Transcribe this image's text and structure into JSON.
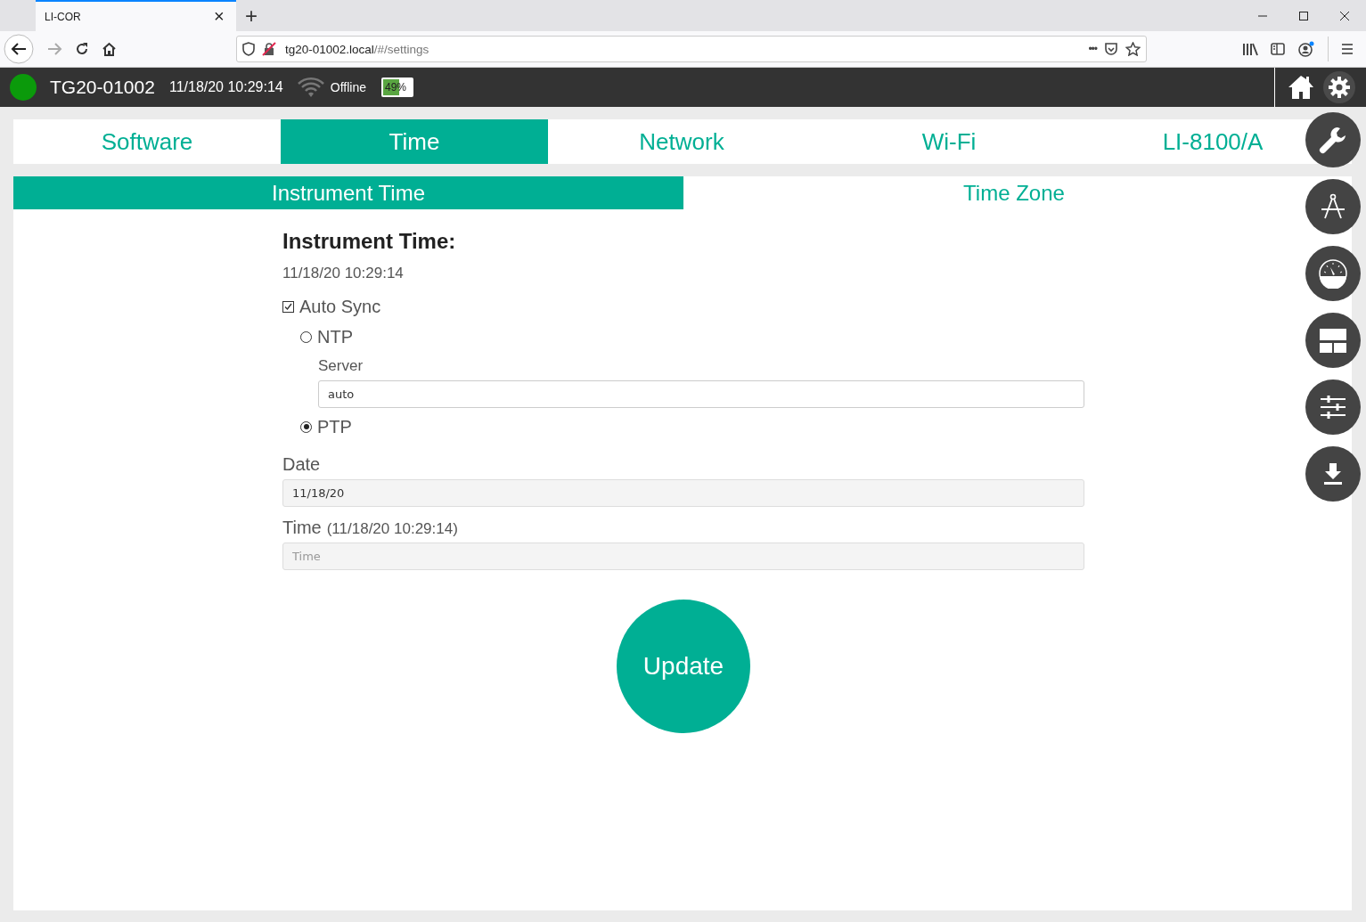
{
  "browser": {
    "tab_title": "LI-COR",
    "tab_close": "×",
    "new_tab": "+",
    "url_host": "tg20-01002.local",
    "url_path": "/#/settings",
    "page_actions": "•••"
  },
  "header": {
    "device": "TG20-01002",
    "datetime": "11/18/20 10:29:14",
    "connection": "Offline",
    "battery": {
      "text": "49%",
      "level": 0.49
    }
  },
  "tabs": [
    {
      "label": "Software",
      "selected": false
    },
    {
      "label": "Time",
      "selected": true
    },
    {
      "label": "Network",
      "selected": false
    },
    {
      "label": "Wi-Fi",
      "selected": false
    },
    {
      "label": "LI-8100/A",
      "selected": false
    }
  ],
  "subtabs": [
    {
      "label": "Instrument Time",
      "selected": true
    },
    {
      "label": "Time Zone",
      "selected": false
    }
  ],
  "form": {
    "heading": "Instrument Time:",
    "current_time": "11/18/20 10:29:14",
    "auto_sync": {
      "label": "Auto Sync",
      "checked": true
    },
    "sync_options": [
      {
        "label": "NTP",
        "selected": false
      },
      {
        "label": "PTP",
        "selected": true
      }
    ],
    "server": {
      "label": "Server",
      "value": "auto"
    },
    "date": {
      "label": "Date",
      "value": "11/18/20"
    },
    "time": {
      "label": "Time",
      "hint": "(11/18/20 10:29:14)",
      "placeholder": "Time"
    },
    "update_button": "Update"
  },
  "side_tools": [
    {
      "kind": "wrench"
    },
    {
      "kind": "compass"
    },
    {
      "kind": "gauge"
    },
    {
      "kind": "layout"
    },
    {
      "kind": "sliders"
    },
    {
      "kind": "download"
    }
  ]
}
